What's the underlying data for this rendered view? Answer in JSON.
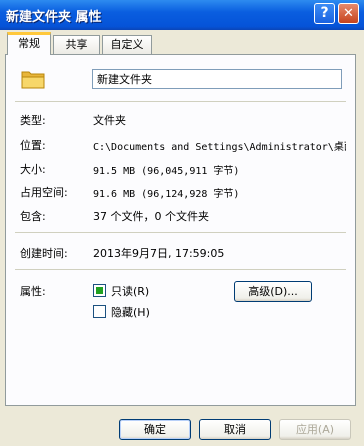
{
  "window": {
    "title": "新建文件夹 属性",
    "help_glyph": "?",
    "close_glyph": "✕"
  },
  "tabs": [
    {
      "label": "常规",
      "active": true
    },
    {
      "label": "共享",
      "active": false
    },
    {
      "label": "自定义",
      "active": false
    }
  ],
  "general": {
    "icon": "folder-icon",
    "name_value": "新建文件夹",
    "rows": {
      "type_label": "类型:",
      "type_value": "文件夹",
      "location_label": "位置:",
      "location_value": "C:\\Documents and Settings\\Administrator\\桌面",
      "size_label": "大小:",
      "size_value": "91.5 MB (96,045,911 字节)",
      "size_on_disk_label": "占用空间:",
      "size_on_disk_value": "91.6 MB (96,124,928 字节)",
      "contains_label": "包含:",
      "contains_value": "37 个文件，0 个文件夹",
      "created_label": "创建时间:",
      "created_value": "2013年9月7日, 17:59:05"
    },
    "attributes": {
      "label": "属性:",
      "readonly_label": "只读(R)",
      "readonly_checked": true,
      "hidden_label": "隐藏(H)",
      "hidden_checked": false,
      "advanced_button": "高级(D)..."
    }
  },
  "buttons": {
    "ok": "确定",
    "cancel": "取消",
    "apply": "应用(A)"
  },
  "colors": {
    "titlebar": "#0a5ee0",
    "dialog_bg": "#ece9d8",
    "panel_bg": "#fcfcfe",
    "active_tab_accent": "#ffc83c",
    "checkbox_mark": "#21a121"
  }
}
